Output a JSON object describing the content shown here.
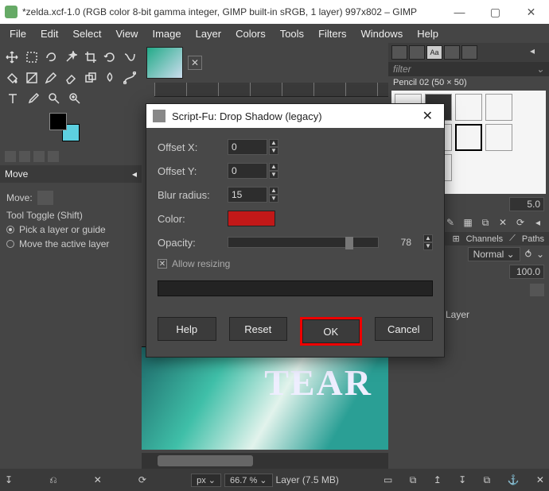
{
  "window": {
    "title": "*zelda.xcf-1.0 (RGB color 8-bit gamma integer, GIMP built-in sRGB, 1 layer) 997x802 – GIMP"
  },
  "menu": [
    "File",
    "Edit",
    "Select",
    "View",
    "Image",
    "Layer",
    "Colors",
    "Tools",
    "Filters",
    "Windows",
    "Help"
  ],
  "left": {
    "move_title": "Move",
    "move_label": "Move:",
    "toggle_title": "Tool Toggle  (Shift)",
    "radio1": "Pick a layer or guide",
    "radio2": "Move the active layer"
  },
  "right": {
    "filter_placeholder": "filter",
    "brush_label": "Pencil 02 (50 × 50)",
    "spinner": "5.0",
    "tab_channels": "Channels",
    "tab_paths": "Paths",
    "mode": "Normal",
    "opacity": "100.0",
    "layer_name": "Layer"
  },
  "dialog": {
    "title": "Script-Fu: Drop Shadow (legacy)",
    "offset_x_label": "Offset X:",
    "offset_x": "0",
    "offset_y_label": "Offset Y:",
    "offset_y": "0",
    "blur_label": "Blur radius:",
    "blur": "15",
    "color_label": "Color:",
    "color": "#c21818",
    "opacity_label": "Opacity:",
    "opacity": "78",
    "allow_label": "Allow resizing",
    "btn_help": "Help",
    "btn_reset": "Reset",
    "btn_ok": "OK",
    "btn_cancel": "Cancel"
  },
  "status": {
    "unit": "px",
    "zoom": "66.7 %",
    "layer_info": "Layer (7.5 MB)"
  },
  "canvas": {
    "word": "TEAR"
  }
}
